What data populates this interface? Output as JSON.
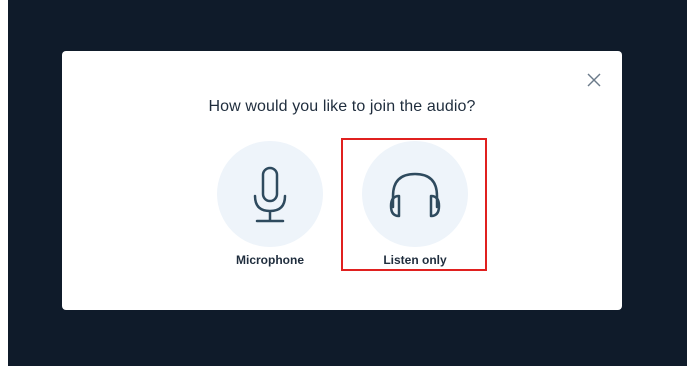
{
  "dialog": {
    "title": "How would you like to join the audio?",
    "close_icon": "close-icon"
  },
  "options": [
    {
      "label": "Microphone",
      "icon": "microphone-icon"
    },
    {
      "label": "Listen only",
      "icon": "headphones-icon"
    }
  ],
  "colors": {
    "backdrop": "#0f1b2a",
    "dialog_bg": "#ffffff",
    "circle_bg": "#eef4fa",
    "icon_stroke": "#2e4a5e",
    "text": "#1f2d3d",
    "highlight": "#e0201f"
  }
}
